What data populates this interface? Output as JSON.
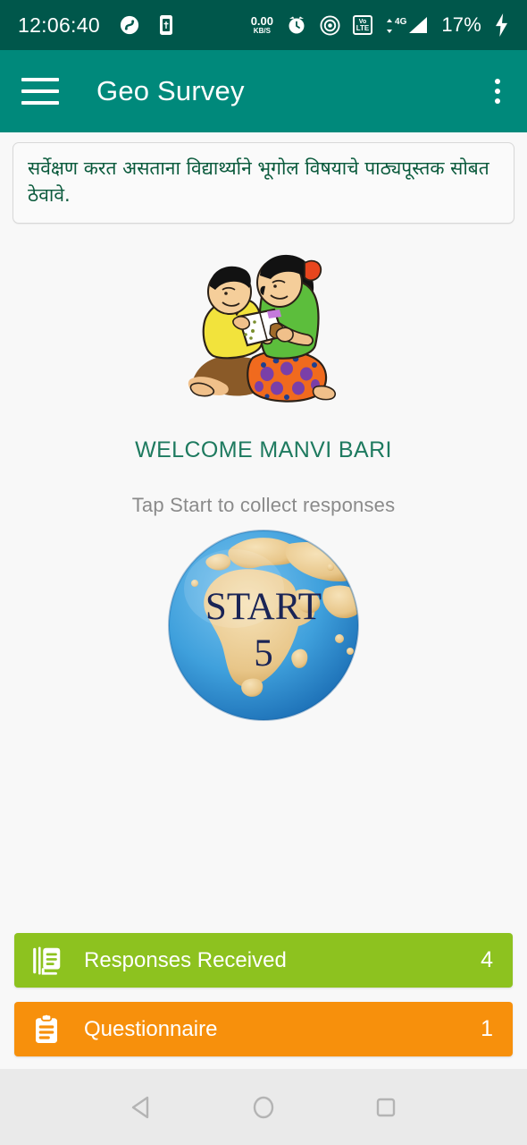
{
  "status_bar": {
    "time": "12:06:40",
    "nfc_icon": "nfc-icon",
    "vibrate_icon": "vibrate-icon",
    "net_speed_value": "0.00",
    "net_speed_unit": "KB/S",
    "alarm_icon": "alarm-clock-icon",
    "hotspot_icon": "hotspot-icon",
    "volte_top": "VoLTE-top",
    "volte_label_1": "Vo",
    "volte_label_2": "LTE",
    "network_type": "4G",
    "battery_percent": "17%",
    "charging_icon": "charging-bolt-icon",
    "bg_color": "#00574B"
  },
  "app_bar": {
    "menu_icon": "hamburger-menu-icon",
    "title": "Geo Survey",
    "overflow_icon": "overflow-menu-icon",
    "bg_color": "#00897B"
  },
  "notice": {
    "text": "सर्वेक्षण करत असताना विद्यार्थ्याने भूगोल विषयाचे पाठ्यपूस्तक सोबत ठेवावे.",
    "text_color": "#0A5A3C"
  },
  "illustration": {
    "name": "two-children-reading-book-illustration"
  },
  "main": {
    "welcome_text": "WELCOME MANVI BARI",
    "welcome_color": "#1E7A5F",
    "tap_hint": "Tap Start to collect responses",
    "tap_hint_color": "#8A8A8A"
  },
  "start_button": {
    "label": "START",
    "count": "5",
    "text_color": "#1A2456",
    "ocean_color": "#3FA0DC",
    "land_color": "#EBCB8E"
  },
  "stats": [
    {
      "icon": "library-books-icon",
      "label": "Responses Received",
      "count": "4",
      "color": "#8DC21F"
    },
    {
      "icon": "clipboard-icon",
      "label": "Questionnaire",
      "count": "1",
      "color": "#F7900C"
    }
  ],
  "nav_bar": {
    "back_icon": "back-triangle-icon",
    "home_icon": "home-circle-icon",
    "recents_icon": "recents-square-icon",
    "bg_color": "#EAEAEA"
  }
}
